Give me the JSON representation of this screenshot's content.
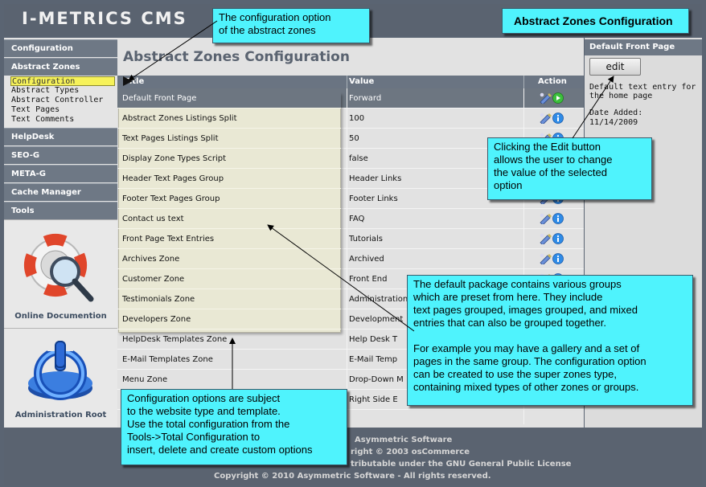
{
  "header": {
    "app_title": "I-METRICS CMS"
  },
  "title_banner": "Abstract Zones Configuration",
  "sidebar": {
    "sections": [
      {
        "label": "Configuration"
      },
      {
        "label": "Abstract Zones"
      },
      {
        "label": "HelpDesk"
      },
      {
        "label": "SEO-G"
      },
      {
        "label": "META-G"
      },
      {
        "label": "Cache Manager"
      },
      {
        "label": "Tools"
      }
    ],
    "subitems": [
      "Configuration",
      "Abstract Types",
      "Abstract Controller",
      "Text Pages",
      "Text Comments"
    ],
    "online_docs_label": "Online Documention",
    "admin_root_label": "Administration Root"
  },
  "main": {
    "page_title": "Abstract Zones Configuration",
    "columns": {
      "title": "Title",
      "value": "Value",
      "action": "Action"
    },
    "rows": [
      {
        "title": "Default Front Page",
        "value": "Forward",
        "selected": true
      },
      {
        "title": "Abstract Zones Listings Split",
        "value": "100"
      },
      {
        "title": "Text Pages Listings Split",
        "value": "50"
      },
      {
        "title": "Display Zone Types Script",
        "value": "false"
      },
      {
        "title": "Header Text Pages Group",
        "value": "Header Links"
      },
      {
        "title": "Footer Text Pages Group",
        "value": "Footer Links"
      },
      {
        "title": "Contact us text",
        "value": "FAQ"
      },
      {
        "title": "Front Page Text Entries",
        "value": "Tutorials"
      },
      {
        "title": "Archives Zone",
        "value": "Archived"
      },
      {
        "title": "Customer Zone",
        "value": "Front End"
      },
      {
        "title": "Testimonials Zone",
        "value": "Administration"
      },
      {
        "title": "Developers Zone",
        "value": "Development"
      },
      {
        "title": "HelpDesk Templates Zone",
        "value": "Help Desk T"
      },
      {
        "title": "E-Mail Templates Zone",
        "value": "E-Mail Temp"
      },
      {
        "title": "Menu Zone",
        "value": "Drop-Down M"
      },
      {
        "title": "",
        "value": "Right Side E"
      }
    ]
  },
  "infobox": {
    "heading": "Default Front Page",
    "edit_label": "edit",
    "description": "Default text entry for the home page",
    "date_label": "Date Added:",
    "date_value": "11/14/2009"
  },
  "footer": {
    "line1": "Asymmetric Software",
    "line2": "right © 2003 osCommerce",
    "line3": "tributable under the GNU General Public License",
    "line4": "Copyright © 2010 Asymmetric Software - All rights reserved."
  },
  "callouts": {
    "config_option": [
      "The configuration option",
      "of the abstract zones"
    ],
    "edit_button": [
      "Clicking the Edit button",
      "allows the user to change",
      "the value of the selected",
      "option"
    ],
    "groups": [
      "The default package contains various groups",
      "which are preset from here. They include",
      "text pages grouped, images grouped, and mixed",
      "entries that can also be grouped together.",
      "",
      "For example you may have a gallery and a set of",
      "pages in the same group. The configuration option",
      "can be created to use the super zones type,",
      "containing mixed types of other zones or groups."
    ],
    "subject": [
      "Configuration options are subject",
      "to the website type and template.",
      "Use the total configuration from the",
      "Tools->Total Configuration to",
      "insert, delete and create custom options"
    ]
  },
  "colors": {
    "callout": "#4ff3fd",
    "header_bg": "#5a6370",
    "highlight": "#f6f25a",
    "overlay": "#e9e8d4"
  },
  "icons": {
    "edit": "edit-pencil-icon",
    "info": "info-icon",
    "select": "select-arrow-icon"
  }
}
